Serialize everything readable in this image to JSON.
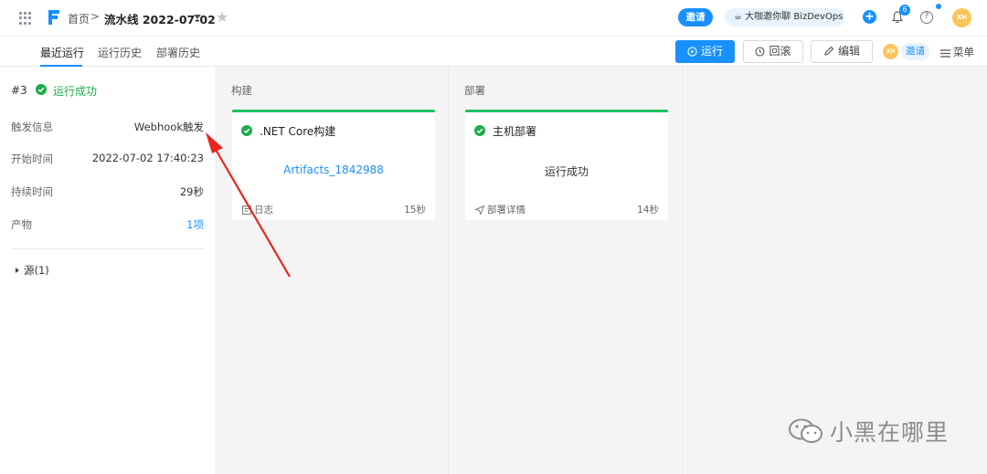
{
  "header": {
    "breadcrumb_home": "首页",
    "breadcrumb_separator": ">",
    "pipeline_title": "流水线 2022-07-02",
    "invite_label": "邀请",
    "coffee_label": "☕ 大咖邀你聊 BizDevOps",
    "plus_label": "+",
    "notification_count": "6",
    "help_label": "?",
    "avatar_initials": "XH"
  },
  "tabs": [
    {
      "label": "最近运行",
      "active": true
    },
    {
      "label": "运行历史",
      "active": false
    },
    {
      "label": "部署历史",
      "active": false
    }
  ],
  "toolbar": {
    "run_label": "运行",
    "rollback_label": "回滚",
    "edit_label": "编辑",
    "avatar_initials": "XH",
    "invite_label": "邀请",
    "menu_label": "菜单"
  },
  "run_info": {
    "run_number": "#3",
    "status": "运行成功",
    "rows": [
      {
        "label": "触发信息",
        "value": "Webhook触发"
      },
      {
        "label": "开始时间",
        "value": "2022-07-02 17:40:23"
      },
      {
        "label": "持续时间",
        "value": "29秒"
      },
      {
        "label": "产物",
        "value": "1项"
      }
    ],
    "source_label": "源(1)"
  },
  "stages": [
    {
      "title": "构建",
      "job": {
        "name": ".NET Core构建",
        "center_text": "Artifacts_1842988",
        "footer_left": "日志",
        "footer_right": "15秒"
      }
    },
    {
      "title": "部署",
      "job": {
        "name": "主机部署",
        "center_text": "运行成功",
        "footer_left": "部署详情",
        "footer_right": "14秒"
      }
    }
  ],
  "watermark": {
    "text": "小黑在哪里"
  },
  "colors": {
    "primary": "#1890ff",
    "success": "#1aad4b",
    "card_top": "#1cc164",
    "annotation": "#e8261f",
    "avatar": "#fbc55c"
  }
}
